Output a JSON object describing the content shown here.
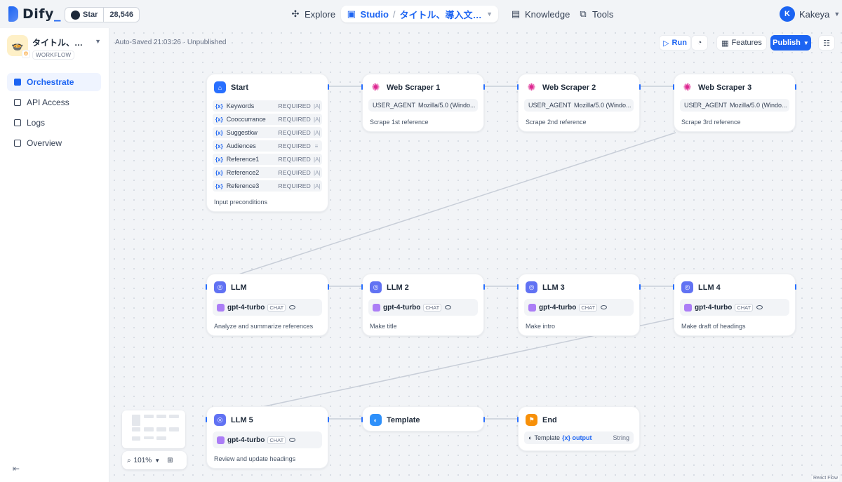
{
  "header": {
    "logo": "Dify",
    "github": {
      "label": "Star",
      "count": "28,546"
    },
    "nav": {
      "explore": "Explore",
      "studio": "Studio",
      "current_app": "タイトル、導入文、見出...",
      "knowledge": "Knowledge",
      "tools": "Tools"
    },
    "user": {
      "initial": "K",
      "name": "Kakeya"
    }
  },
  "sidebar": {
    "app_name": "タイトル、導入...",
    "app_type": "WORKFLOW",
    "items": [
      {
        "label": "Orchestrate",
        "icon": "orchestrate-icon",
        "active": true
      },
      {
        "label": "API Access",
        "icon": "terminal-icon",
        "active": false
      },
      {
        "label": "Logs",
        "icon": "logs-icon",
        "active": false
      },
      {
        "label": "Overview",
        "icon": "chart-icon",
        "active": false
      }
    ]
  },
  "toolbar": {
    "autosave": "Auto-Saved 21:03:26 · Unpublished",
    "run": "Run",
    "features": "Features",
    "publish": "Publish"
  },
  "nodes": {
    "start": {
      "title": "Start",
      "vars": [
        {
          "name": "Keywords",
          "req": "REQUIRED"
        },
        {
          "name": "Cooccurrance",
          "req": "REQUIRED"
        },
        {
          "name": "Suggestkw",
          "req": "REQUIRED"
        },
        {
          "name": "Audiences",
          "req": "REQUIRED"
        },
        {
          "name": "Reference1",
          "req": "REQUIRED"
        },
        {
          "name": "Reference2",
          "req": "REQUIRED"
        },
        {
          "name": "Reference3",
          "req": "REQUIRED"
        }
      ],
      "var_prefix": "{x}",
      "desc": "Input preconditions"
    },
    "scraper1": {
      "title": "Web Scraper 1",
      "param_key": "USER_AGENT",
      "param_val": "Mozilla/5.0 (Windo...",
      "desc": "Scrape 1st reference"
    },
    "scraper2": {
      "title": "Web Scraper 2",
      "param_key": "USER_AGENT",
      "param_val": "Mozilla/5.0 (Windo...",
      "desc": "Scrape 2nd reference"
    },
    "scraper3": {
      "title": "Web Scraper 3",
      "param_key": "USER_AGENT",
      "param_val": "Mozilla/5.0 (Windo...",
      "desc": "Scrape 3rd reference"
    },
    "llm1": {
      "title": "LLM",
      "model": "gpt-4-turbo",
      "mode": "CHAT",
      "desc": "Analyze and summarize references"
    },
    "llm2": {
      "title": "LLM 2",
      "model": "gpt-4-turbo",
      "mode": "CHAT",
      "desc": "Make title"
    },
    "llm3": {
      "title": "LLM 3",
      "model": "gpt-4-turbo",
      "mode": "CHAT",
      "desc": "Make intro"
    },
    "llm4": {
      "title": "LLM 4",
      "model": "gpt-4-turbo",
      "mode": "CHAT",
      "desc": "Make draft of headings"
    },
    "llm5": {
      "title": "LLM 5",
      "model": "gpt-4-turbo",
      "mode": "CHAT",
      "desc": "Review and update headings"
    },
    "template": {
      "title": "Template"
    },
    "end": {
      "title": "End",
      "source": "Template",
      "var": "{x} output",
      "type": "String"
    }
  },
  "zoom": {
    "level": "101%"
  },
  "attribution": "React Flow",
  "colors": {
    "accent": "#1c64f2",
    "scraper": "#dd2590",
    "llm": "#6172f3",
    "end": "#f79009"
  }
}
